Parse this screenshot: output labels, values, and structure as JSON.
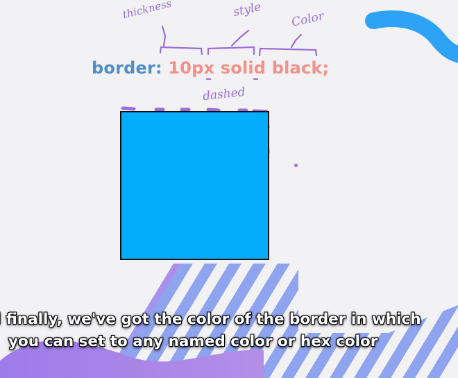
{
  "annotations": {
    "thickness": "thickness",
    "style": "style",
    "color": "Color",
    "dashed": "dashed"
  },
  "code": {
    "property": "border:",
    "value_thickness": "10px",
    "value_style": "solid",
    "value_color": "black;"
  },
  "subtitles": {
    "line1": "l finally, we've got the color of the border in which",
    "line2": "you can set to any named color or hex color"
  },
  "colors": {
    "box_fill": "#03adfb",
    "code_property": "#4f8fc6",
    "code_value": "#f0918a",
    "ink": "#9b6fd8"
  }
}
